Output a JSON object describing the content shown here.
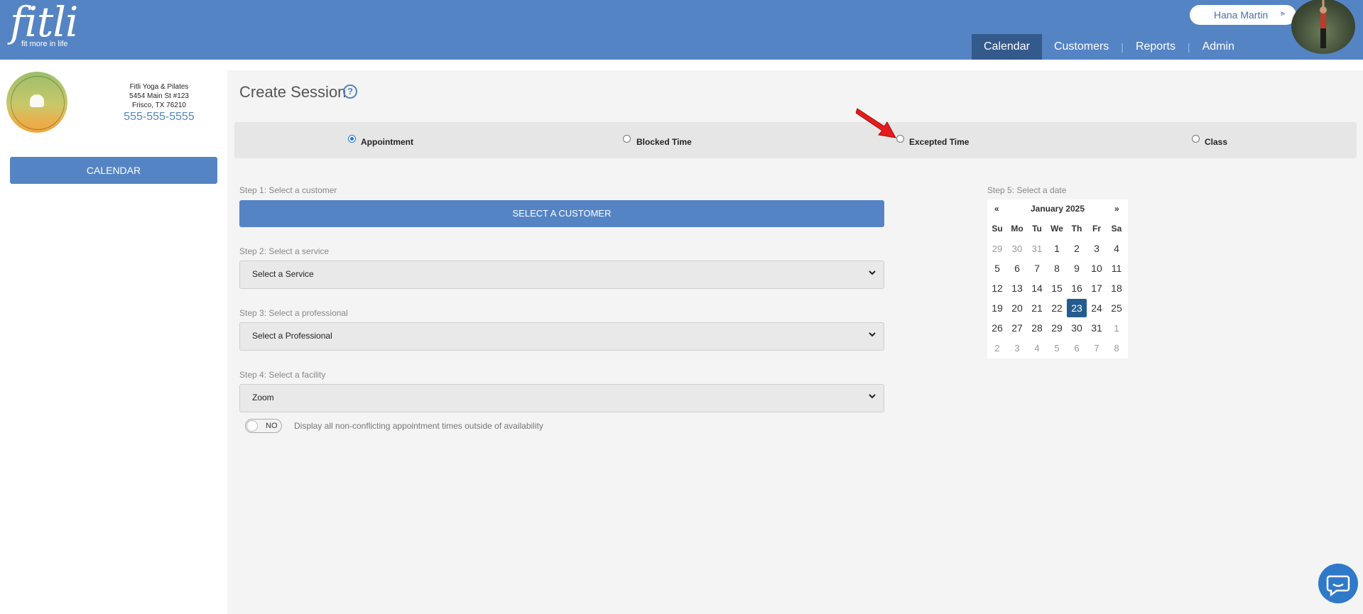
{
  "header": {
    "logo_word": "fitli",
    "logo_tagline": "fit more in life",
    "user_name": "Hana Martin",
    "nav": [
      "Calendar",
      "Customers",
      "Reports",
      "Admin"
    ]
  },
  "sidebar": {
    "address_line1": "Fitli Yoga & Pilates",
    "address_line2": "5454 Main St #123",
    "address_line3": "Frisco, TX 76210",
    "phone": "555-555-5555",
    "calendar_button": "CALENDAR"
  },
  "main": {
    "title": "Create Session",
    "help": "?",
    "session_types": [
      {
        "label": "Appointment",
        "selected": true
      },
      {
        "label": "Blocked Time",
        "selected": false
      },
      {
        "label": "Excepted Time",
        "selected": false
      },
      {
        "label": "Class",
        "selected": false
      }
    ],
    "step1": "Step 1: Select a customer",
    "select_customer": "SELECT A CUSTOMER",
    "step2": "Step 2: Select a service",
    "service_value": "Select a Service",
    "step3": "Step 3: Select a professional",
    "professional_value": "Select a Professional",
    "step4": "Step 4: Select a facility",
    "facility_value": "Zoom",
    "toggle_label": "NO",
    "toggle_text": "Display all non-conflicting appointment times outside of availability",
    "step5": "Step 5: Select a date"
  },
  "calendar": {
    "prev": "«",
    "next": "»",
    "month": "January 2025",
    "weekdays": [
      "Su",
      "Mo",
      "Tu",
      "We",
      "Th",
      "Fr",
      "Sa"
    ],
    "weeks": [
      [
        "29",
        "30",
        "31",
        "1",
        "2",
        "3",
        "4"
      ],
      [
        "5",
        "6",
        "7",
        "8",
        "9",
        "10",
        "11"
      ],
      [
        "12",
        "13",
        "14",
        "15",
        "16",
        "17",
        "18"
      ],
      [
        "19",
        "20",
        "21",
        "22",
        "23",
        "24",
        "25"
      ],
      [
        "26",
        "27",
        "28",
        "29",
        "30",
        "31",
        "1"
      ],
      [
        "2",
        "3",
        "4",
        "5",
        "6",
        "7",
        "8"
      ]
    ],
    "selected": "23"
  },
  "colors": {
    "brand": "#5584c4",
    "nav_active": "#345a8c",
    "selected_day": "#245c8f"
  }
}
